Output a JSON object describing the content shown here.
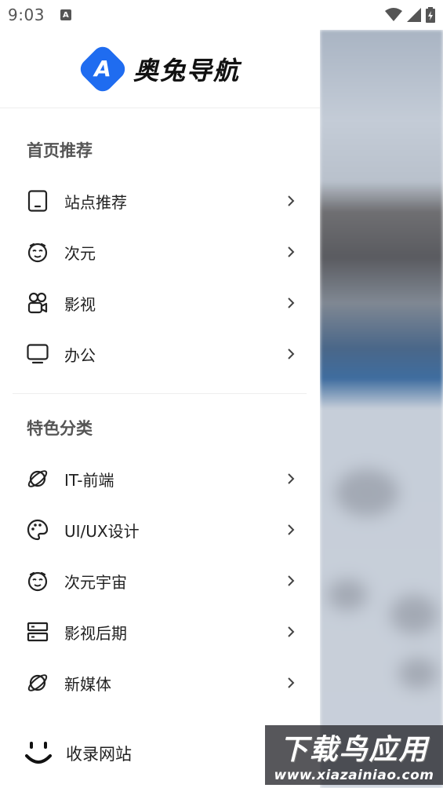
{
  "status_bar": {
    "time": "9:03",
    "notification_letter": "A"
  },
  "drawer": {
    "brand_name": "奥兔导航",
    "brand_letter": "A",
    "brand_color": "#1f6cf0",
    "sections": [
      {
        "title": "首页推荐",
        "items": [
          {
            "label": "站点推荐",
            "icon": "tablet-icon"
          },
          {
            "label": "次元",
            "icon": "face-icon"
          },
          {
            "label": "影视",
            "icon": "film-icon"
          },
          {
            "label": "办公",
            "icon": "monitor-icon"
          }
        ]
      },
      {
        "title": "特色分类",
        "items": [
          {
            "label": "IT-前端",
            "icon": "planet-icon"
          },
          {
            "label": "UI/UX设计",
            "icon": "palette-icon"
          },
          {
            "label": "次元宇宙",
            "icon": "face-icon"
          },
          {
            "label": "影视后期",
            "icon": "server-icon"
          },
          {
            "label": "新媒体",
            "icon": "planet-icon"
          }
        ]
      }
    ],
    "bottom_item": {
      "label": "收录网站",
      "icon": "smile-icon"
    }
  },
  "watermark": {
    "main": "下载鸟应用",
    "url": "www.xiazainiao.com"
  }
}
